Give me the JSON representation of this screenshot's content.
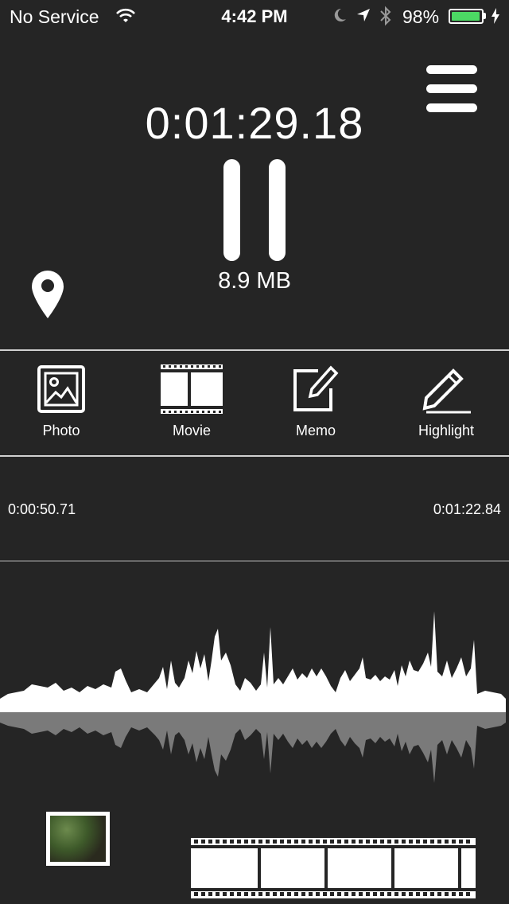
{
  "status_bar": {
    "carrier": "No Service",
    "time": "4:42 PM",
    "battery_percent": "98%",
    "battery_level": 0.98,
    "icons": [
      "wifi-icon",
      "moon-icon",
      "location-arrow-icon",
      "bluetooth-icon",
      "battery-icon",
      "charging-bolt-icon"
    ]
  },
  "recorder": {
    "elapsed_time": "0:01:29.18",
    "file_size": "8.9 MB",
    "state": "recording",
    "controls": [
      "menu-icon",
      "pause-icon",
      "location-pin-icon"
    ]
  },
  "toolbar": {
    "items": [
      {
        "label": "Photo",
        "icon": "photo-icon"
      },
      {
        "label": "Movie",
        "icon": "movie-film-icon"
      },
      {
        "label": "Memo",
        "icon": "memo-edit-icon"
      },
      {
        "label": "Highlight",
        "icon": "highlight-pencil-icon"
      }
    ]
  },
  "timeline": {
    "start_time": "0:00:50.71",
    "end_time": "0:01:22.84"
  },
  "colors": {
    "background": "#252525",
    "foreground": "#ffffff",
    "battery": "#4cd964",
    "waveform_reflection": "#7a7a7a"
  }
}
